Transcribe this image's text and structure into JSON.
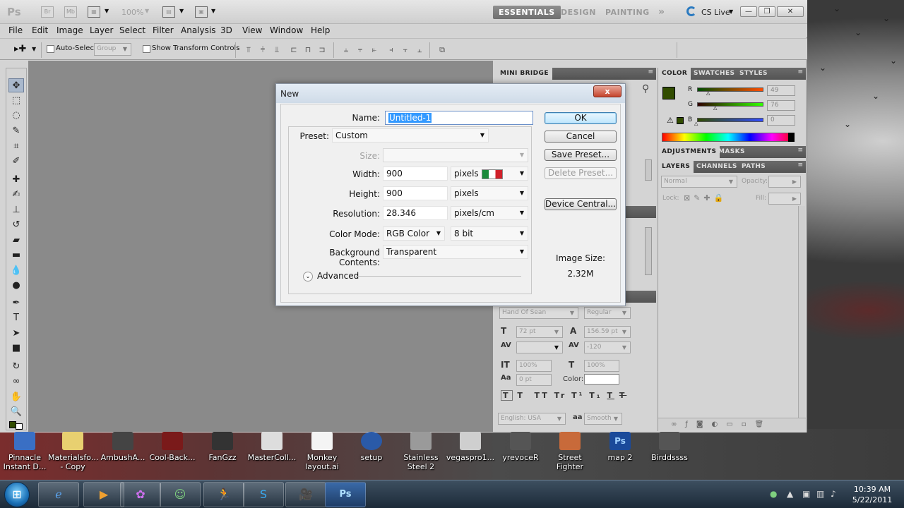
{
  "titlebar": {
    "app_logo": "Ps",
    "bridge_label": "Br",
    "minibridge_label": "Mb",
    "zoom": "100%",
    "workspaces": [
      "ESSENTIALS",
      "DESIGN",
      "PAINTING"
    ],
    "more_label": "»",
    "cs_live": "CS Live"
  },
  "menu": [
    "File",
    "Edit",
    "Image",
    "Layer",
    "Select",
    "Filter",
    "Analysis",
    "3D",
    "View",
    "Window",
    "Help"
  ],
  "options_bar": {
    "auto_select_label": "Auto-Select:",
    "auto_select_value": "Group",
    "show_transform_label": "Show Transform Controls"
  },
  "mini_bridge": {
    "tab": "MINI BRIDGE"
  },
  "character_panel": {
    "font_family": "Hand Of Sean",
    "font_style": "Regular",
    "font_size": "72 pt",
    "leading": "156.59 pt",
    "tracking": "-120",
    "vertical_scale": "100%",
    "horizontal_scale": "100%",
    "baseline_shift": "0 pt",
    "color_label": "Color:",
    "language": "English: USA",
    "anti_alias_label": "aa",
    "anti_alias": "Smooth"
  },
  "color_panel": {
    "tabs": [
      "COLOR",
      "SWATCHES",
      "STYLES"
    ],
    "r_label": "R",
    "g_label": "G",
    "b_label": "B",
    "r": "49",
    "g": "76",
    "b": "0",
    "foreground": "#314c00"
  },
  "adjustments_panel": {
    "tabs": [
      "ADJUSTMENTS",
      "MASKS"
    ]
  },
  "layers_panel": {
    "tabs": [
      "LAYERS",
      "CHANNELS",
      "PATHS"
    ],
    "blend_mode": "Normal",
    "opacity_label": "Opacity:",
    "lock_label": "Lock:",
    "fill_label": "Fill:"
  },
  "dialog": {
    "title": "New",
    "close": "x",
    "name_label": "Name:",
    "name_value": "Untitled-1",
    "preset_label": "Preset:",
    "preset_value": "Custom",
    "size_label": "Size:",
    "width_label": "Width:",
    "width_value": "900",
    "width_unit": "pixels",
    "height_label": "Height:",
    "height_value": "900",
    "height_unit": "pixels",
    "resolution_label": "Resolution:",
    "resolution_value": "28.346",
    "resolution_unit": "pixels/cm",
    "color_mode_label": "Color Mode:",
    "color_mode_value": "RGB Color",
    "bit_depth": "8 bit",
    "background_label": "Background Contents:",
    "background_value": "Transparent",
    "advanced_label": "Advanced",
    "image_size_label": "Image Size:",
    "image_size_value": "2.32M",
    "buttons": {
      "ok": "OK",
      "cancel": "Cancel",
      "save_preset": "Save Preset...",
      "delete_preset": "Delete Preset...",
      "device_central": "Device Central..."
    }
  },
  "desktop_icons": [
    {
      "label1": "Pinnacle",
      "label2": "Instant D...",
      "color": "#3a6fc4"
    },
    {
      "label1": "Materialsfo...",
      "label2": "- Copy",
      "color": "#e8d070"
    },
    {
      "label1": "AmbushA...",
      "label2": "",
      "color": "#444444"
    },
    {
      "label1": "Cool-Back...",
      "label2": "",
      "color": "#7a1a1a"
    },
    {
      "label1": "FanGzz",
      "label2": "",
      "color": "#333333"
    },
    {
      "label1": "MasterColl...",
      "label2": "",
      "color": "#dddddd"
    },
    {
      "label1": "Monkey",
      "label2": "layout.ai",
      "color": "#f4f4f4"
    },
    {
      "label1": "setup",
      "label2": "",
      "color": "#2a5aa8"
    },
    {
      "label1": "Stainless",
      "label2": "Steel 2",
      "color": "#9a9a9a"
    },
    {
      "label1": "vegaspro1...",
      "label2": "",
      "color": "#cfcfcf"
    },
    {
      "label1": "yrevoceR",
      "label2": "",
      "color": "#555555"
    },
    {
      "label1": "Street Fighter",
      "label2": "",
      "color": "#c86a3a"
    },
    {
      "label1": "map 2",
      "label2": "",
      "color": "#1a4a9a"
    },
    {
      "label1": "Birddssss",
      "label2": "",
      "color": "#555555"
    }
  ],
  "taskbar": {
    "start": "⊞",
    "ps_label": "Ps",
    "time": "10:39 AM",
    "date": "5/22/2011"
  }
}
